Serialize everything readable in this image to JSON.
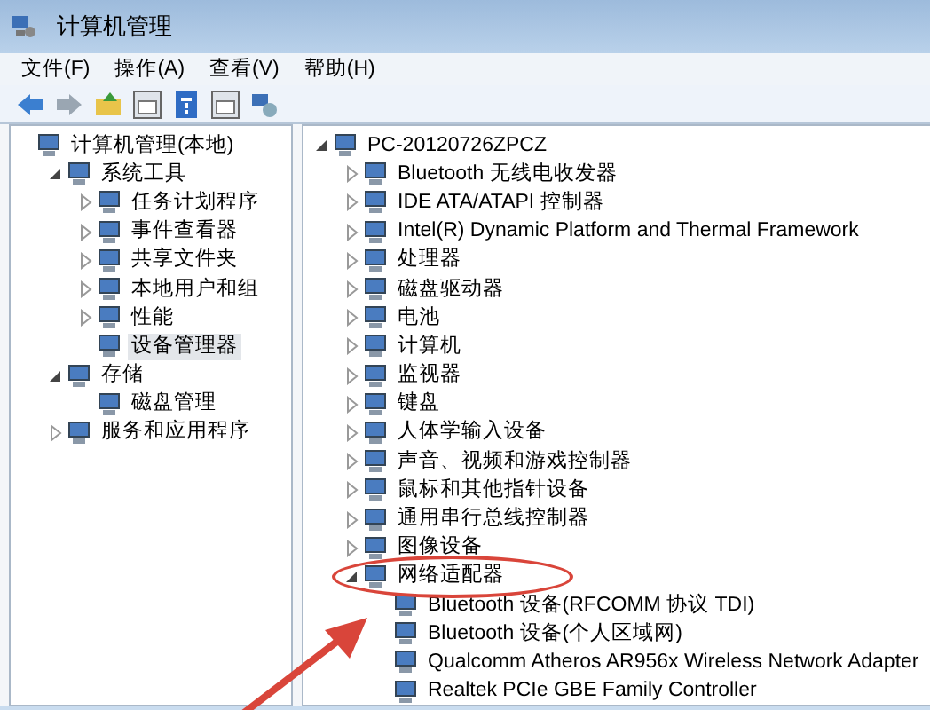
{
  "window": {
    "title": "计算机管理"
  },
  "menu": [
    "文件(F)",
    "操作(A)",
    "查看(V)",
    "帮助(H)"
  ],
  "toolbar": [
    {
      "kind": "back",
      "disabled": false
    },
    {
      "kind": "forward",
      "disabled": true
    },
    {
      "kind": "up"
    },
    {
      "kind": "panel"
    },
    {
      "kind": "help"
    },
    {
      "kind": "panel"
    },
    {
      "kind": "device"
    }
  ],
  "left_tree": [
    {
      "label": "计算机管理(本地)",
      "selected": false,
      "children": [
        {
          "label": "系统工具",
          "expanded": true,
          "selected": false,
          "children": [
            {
              "label": "任务计划程序",
              "expanded": false,
              "selected": false
            },
            {
              "label": "事件查看器",
              "expanded": false,
              "selected": false
            },
            {
              "label": "共享文件夹",
              "expanded": false,
              "selected": false
            },
            {
              "label": "本地用户和组",
              "expanded": false,
              "selected": false
            },
            {
              "label": "性能",
              "expanded": false,
              "selected": false
            },
            {
              "label": "设备管理器",
              "selected": true
            }
          ]
        },
        {
          "label": "存储",
          "expanded": true,
          "selected": false,
          "children": [
            {
              "label": "磁盘管理",
              "selected": false
            }
          ]
        },
        {
          "label": "服务和应用程序",
          "expanded": false,
          "selected": false
        }
      ]
    }
  ],
  "device_tree": [
    {
      "label": "PC-20120726ZPCZ",
      "expanded": true,
      "children": [
        {
          "label": "Bluetooth 无线电收发器",
          "expanded": false
        },
        {
          "label": "IDE ATA/ATAPI 控制器",
          "expanded": false
        },
        {
          "label": "Intel(R) Dynamic Platform and Thermal Framework",
          "expanded": false
        },
        {
          "label": "处理器",
          "expanded": false
        },
        {
          "label": "磁盘驱动器",
          "expanded": false
        },
        {
          "label": "电池",
          "expanded": false
        },
        {
          "label": "计算机",
          "expanded": false
        },
        {
          "label": "监视器",
          "expanded": false
        },
        {
          "label": "键盘",
          "expanded": false
        },
        {
          "label": "人体学输入设备",
          "expanded": false
        },
        {
          "label": "声音、视频和游戏控制器",
          "expanded": false
        },
        {
          "label": "鼠标和其他指针设备",
          "expanded": false
        },
        {
          "label": "通用串行总线控制器",
          "expanded": false
        },
        {
          "label": "图像设备",
          "expanded": false
        },
        {
          "label": "网络适配器",
          "expanded": true,
          "highlighted": true,
          "children": [
            {
              "label": "Bluetooth 设备(RFCOMM 协议 TDI)"
            },
            {
              "label": "Bluetooth 设备(个人区域网)"
            },
            {
              "label": "Qualcomm Atheros AR956x Wireless Network Adapter"
            },
            {
              "label": "Realtek PCIe GBE Family Controller"
            }
          ]
        }
      ]
    }
  ]
}
